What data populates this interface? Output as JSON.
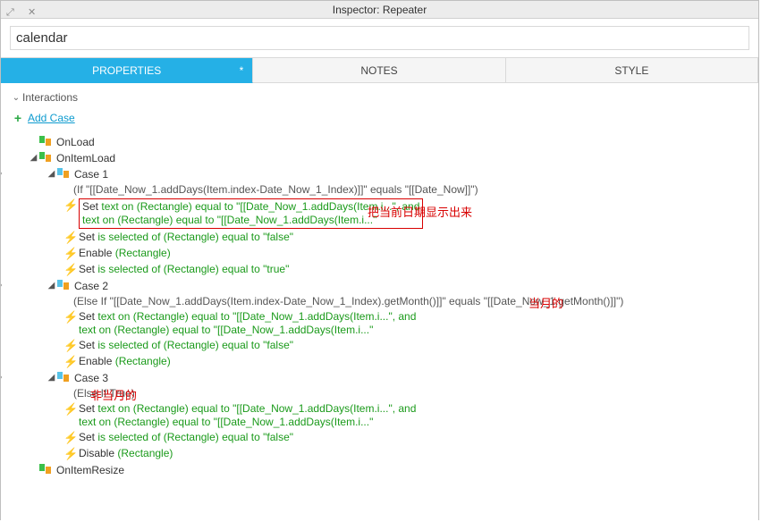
{
  "window": {
    "title": "Inspector: Repeater"
  },
  "widget": {
    "name": "calendar"
  },
  "tabs": {
    "properties": "PROPERTIES",
    "dirty": "*",
    "notes": "NOTES",
    "style": "STYLE"
  },
  "section": {
    "interactions": "Interactions",
    "addCase": "Add Case"
  },
  "events": {
    "onLoad": "OnLoad",
    "onItemLoad": "OnItemLoad",
    "onItemResize": "OnItemResize"
  },
  "c1": {
    "name": "Case 1",
    "cond": "(If \"[[Date_Now_1.addDays(Item.index-Date_Now_1_Index)]]\" equals \"[[Date_Now]]\")",
    "a1a": "Set ",
    "a1b": "text on (Rectangle) equal to \"[[Date_Now_1.addDays(Item.i...\", and",
    "a1c": "text on (Rectangle) equal to \"[[Date_Now_1.addDays(Item.i...\"",
    "a2a": "Set ",
    "a2b": "is selected of (Rectangle) equal to \"false\"",
    "a3a": "Enable ",
    "a3b": "(Rectangle)",
    "a4a": "Set ",
    "a4b": "is selected of (Rectangle) equal to \"true\""
  },
  "c2": {
    "name": "Case 2",
    "cond": "(Else If \"[[Date_Now_1.addDays(Item.index-Date_Now_1_Index).getMonth()]]\" equals \"[[Date_Now_1.getMonth()]]\")",
    "a1a": "Set ",
    "a1b": "text on (Rectangle) equal to \"[[Date_Now_1.addDays(Item.i...\", and",
    "a1c": "text on (Rectangle) equal to \"[[Date_Now_1.addDays(Item.i...\"",
    "a2a": "Set ",
    "a2b": "is selected of (Rectangle) equal to \"false\"",
    "a3a": "Enable ",
    "a3b": "(Rectangle)"
  },
  "c3": {
    "name": "Case 3",
    "cond": "(Else If True)",
    "a1a": "Set ",
    "a1b": "text on (Rectangle) equal to \"[[Date_Now_1.addDays(Item.i...\", and",
    "a1c": "text on (Rectangle) equal to \"[[Date_Now_1.addDays(Item.i...\"",
    "a2a": "Set ",
    "a2b": "is selected of (Rectangle) equal to \"false\"",
    "a3a": "Disable ",
    "a3b": "(Rectangle)"
  },
  "annot": {
    "a1": "把当前日期显示出来",
    "a2": "当月的",
    "a3": "非当月的"
  }
}
